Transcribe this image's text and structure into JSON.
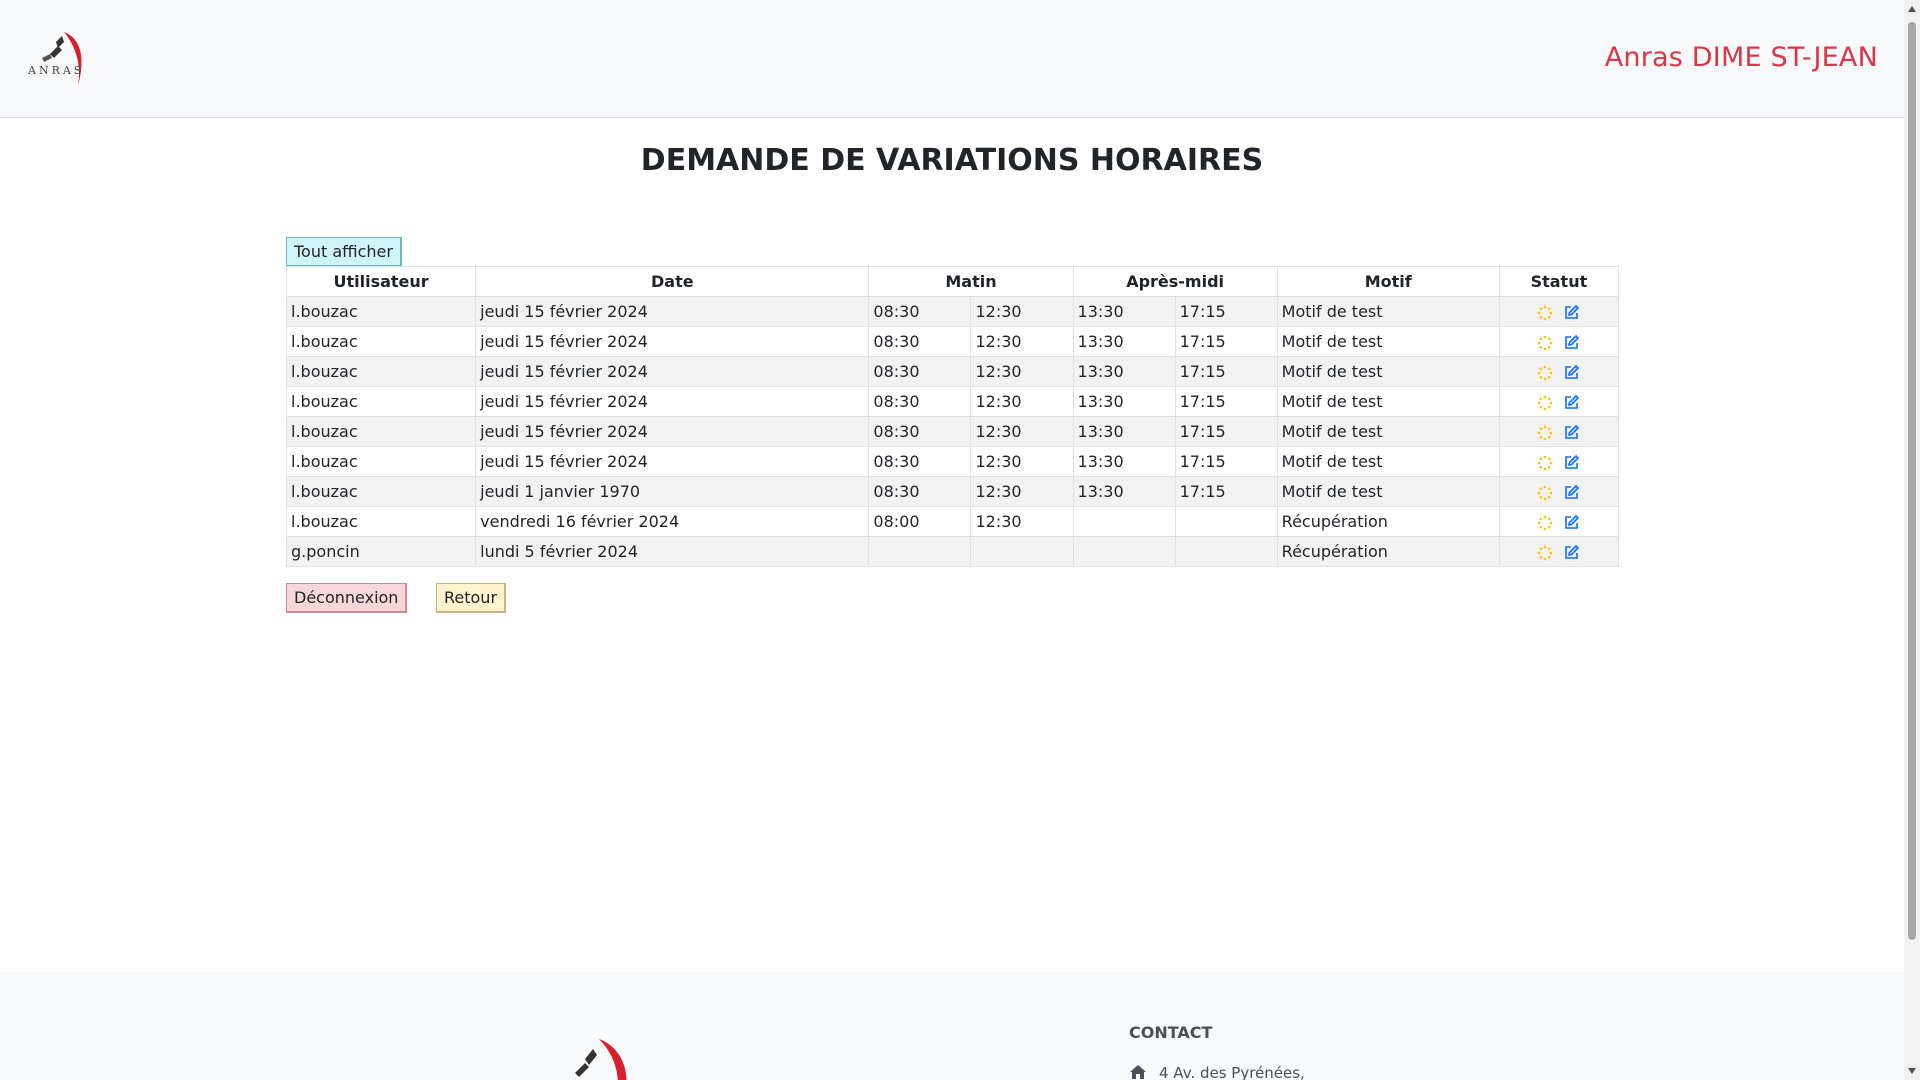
{
  "header": {
    "logo_text": "ANRAS",
    "brand": "Anras DIME ST-JEAN"
  },
  "page": {
    "title": "DEMANDE DE VARIATIONS HORAIRES",
    "show_all_label": "Tout afficher",
    "logout_label": "Déconnexion",
    "back_label": "Retour"
  },
  "table": {
    "headers": {
      "user": "Utilisateur",
      "date": "Date",
      "morning": "Matin",
      "afternoon": "Après-midi",
      "reason": "Motif",
      "status": "Statut"
    },
    "rows": [
      {
        "user": "l.bouzac",
        "date": "jeudi 15 février 2024",
        "m_start": "08:30",
        "m_end": "12:30",
        "a_start": "13:30",
        "a_end": "17:15",
        "reason": "Motif de test"
      },
      {
        "user": "l.bouzac",
        "date": "jeudi 15 février 2024",
        "m_start": "08:30",
        "m_end": "12:30",
        "a_start": "13:30",
        "a_end": "17:15",
        "reason": "Motif de test"
      },
      {
        "user": "l.bouzac",
        "date": "jeudi 15 février 2024",
        "m_start": "08:30",
        "m_end": "12:30",
        "a_start": "13:30",
        "a_end": "17:15",
        "reason": "Motif de test"
      },
      {
        "user": "l.bouzac",
        "date": "jeudi 15 février 2024",
        "m_start": "08:30",
        "m_end": "12:30",
        "a_start": "13:30",
        "a_end": "17:15",
        "reason": "Motif de test"
      },
      {
        "user": "l.bouzac",
        "date": "jeudi 15 février 2024",
        "m_start": "08:30",
        "m_end": "12:30",
        "a_start": "13:30",
        "a_end": "17:15",
        "reason": "Motif de test"
      },
      {
        "user": "l.bouzac",
        "date": "jeudi 15 février 2024",
        "m_start": "08:30",
        "m_end": "12:30",
        "a_start": "13:30",
        "a_end": "17:15",
        "reason": "Motif de test"
      },
      {
        "user": "l.bouzac",
        "date": "jeudi 1 janvier 1970",
        "m_start": "08:30",
        "m_end": "12:30",
        "a_start": "13:30",
        "a_end": "17:15",
        "reason": "Motif de test"
      },
      {
        "user": "l.bouzac",
        "date": "vendredi 16 février 2024",
        "m_start": "08:00",
        "m_end": "12:30",
        "a_start": "",
        "a_end": "",
        "reason": "Récupération"
      },
      {
        "user": "g.poncin",
        "date": "lundi 5 février 2024",
        "m_start": "",
        "m_end": "",
        "a_start": "",
        "a_end": "",
        "reason": "Récupération"
      }
    ],
    "status_icons": [
      "pending-spinner-icon",
      "edit-icon"
    ]
  },
  "colors": {
    "brand_red": "#dc3545",
    "pending_yellow": "#ffc107",
    "edit_blue": "#0d6efd",
    "info_bg": "#cff4fc",
    "danger_bg": "#f8d7da",
    "warning_bg": "#fff3cd"
  },
  "footer": {
    "contact_title": "CONTACT",
    "address_line": "4 Av. des Pyrénées,"
  }
}
